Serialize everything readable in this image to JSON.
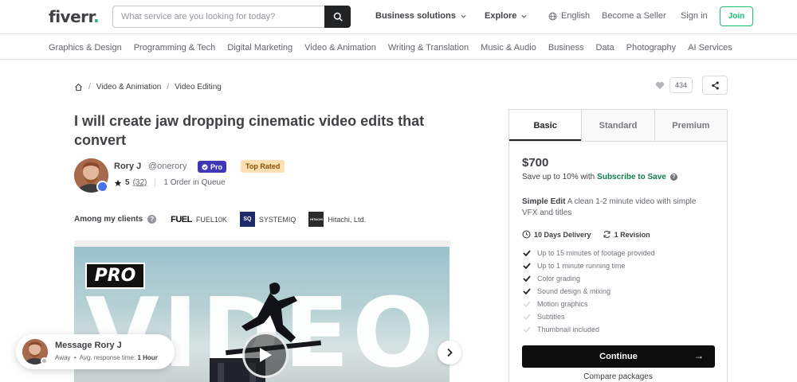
{
  "header": {
    "logo_text": "fiverr",
    "logo_dot": ".",
    "search_placeholder": "What service are you looking for today?",
    "business_solutions": "Business solutions",
    "explore": "Explore",
    "language": "English",
    "become_seller": "Become a Seller",
    "sign_in": "Sign in",
    "join": "Join"
  },
  "categories": [
    "Graphics & Design",
    "Programming & Tech",
    "Digital Marketing",
    "Video & Animation",
    "Writing & Translation",
    "Music & Audio",
    "Business",
    "Data",
    "Photography",
    "AI Services"
  ],
  "breadcrumb": [
    "Video & Animation",
    "Video Editing"
  ],
  "favorites_count": "434",
  "gig": {
    "title": "I will create jaw dropping cinematic video edits that convert"
  },
  "seller": {
    "name": "Rory J",
    "handle": "@onerory",
    "pro_label": "Pro",
    "top_rated": "Top Rated",
    "rating": "5",
    "reviews": "(32)",
    "queue": "1 Order in Queue"
  },
  "clients": {
    "label": "Among my clients",
    "items": [
      {
        "logo": "FUEL",
        "name": "FUEL10K",
        "color": "#ffffff"
      },
      {
        "logo": "SQ",
        "name": "SYSTEMIQ",
        "color": "#1f2a6b"
      },
      {
        "logo": "HITACHI",
        "name": "Hitachi, Ltd.",
        "color": "#2b2b2b"
      }
    ]
  },
  "video": {
    "pro_tag": "PRO",
    "big_word": "VIDEO"
  },
  "message": {
    "title": "Message Rory J",
    "status": "Away",
    "response_label": "Avg. response time:",
    "response_value": "1 Hour"
  },
  "packages": {
    "tabs": [
      "Basic",
      "Standard",
      "Premium"
    ],
    "active_tab": "Basic",
    "price": "$700",
    "save_text": "Save up to 10% with",
    "subscribe_text": "Subscribe to Save",
    "package_name": "Simple Edit",
    "description": "A clean 1-2 minute video with simple VFX and titles",
    "delivery": "10 Days Delivery",
    "revisions": "1 Revision",
    "features": [
      {
        "text": "Up to 15 minutes of footage provided",
        "included": true
      },
      {
        "text": "Up to 1 minute running time",
        "included": true
      },
      {
        "text": "Color grading",
        "included": true
      },
      {
        "text": "Sound design & mixing",
        "included": true
      },
      {
        "text": "Motion graphics",
        "included": false
      },
      {
        "text": "Subtitles",
        "included": false
      },
      {
        "text": "Thumbnail included",
        "included": false
      }
    ],
    "continue_label": "Continue",
    "compare_label": "Compare packages"
  },
  "colors": {
    "brand_green": "#1dbf73",
    "pro_purple": "#3f36b8",
    "top_rated_bg": "#ffe0b3",
    "continue_bg": "#0d0d0d"
  }
}
